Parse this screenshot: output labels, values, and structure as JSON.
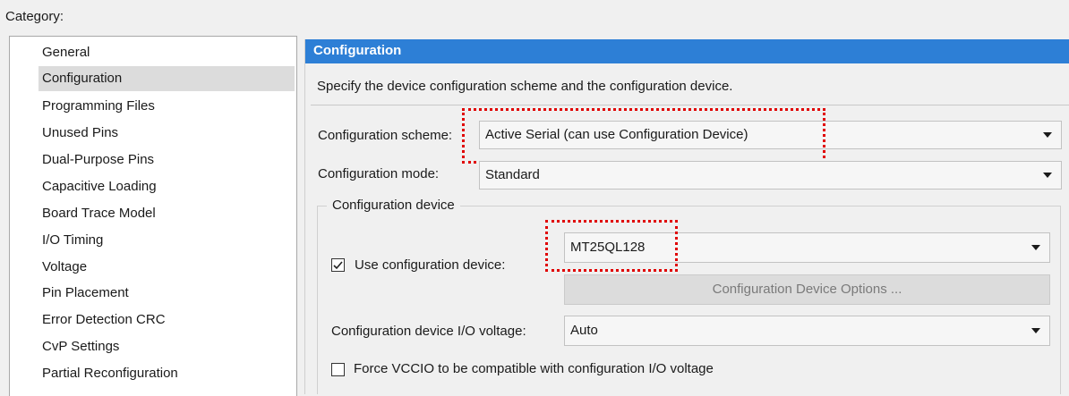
{
  "category": {
    "label": "Category:",
    "items": [
      {
        "label": "General"
      },
      {
        "label": "Configuration",
        "selected": true
      },
      {
        "label": "Programming Files"
      },
      {
        "label": "Unused Pins"
      },
      {
        "label": "Dual-Purpose Pins"
      },
      {
        "label": "Capacitive Loading"
      },
      {
        "label": "Board Trace Model"
      },
      {
        "label": "I/O Timing"
      },
      {
        "label": "Voltage"
      },
      {
        "label": "Pin Placement"
      },
      {
        "label": "Error Detection CRC"
      },
      {
        "label": "CvP Settings"
      },
      {
        "label": "Partial Reconfiguration"
      }
    ]
  },
  "panel": {
    "title": "Configuration",
    "description": "Specify the device configuration scheme and the configuration device.",
    "scheme": {
      "label": "Configuration scheme:",
      "value": "Active Serial (can use Configuration Device)"
    },
    "mode": {
      "label": "Configuration mode:",
      "value": "Standard"
    },
    "device_group": {
      "title": "Configuration device",
      "use_device": {
        "label": "Use configuration device:",
        "checked": true
      },
      "device": {
        "value": "MT25QL128"
      },
      "options_button": "Configuration Device Options ...",
      "io_voltage": {
        "label": "Configuration device I/O voltage:",
        "value": "Auto"
      },
      "force_vccio": {
        "label": "Force VCCIO to be compatible with configuration I/O voltage",
        "checked": false
      }
    }
  },
  "colors": {
    "header_bg": "#2d7fd6",
    "selected_item_bg": "#dcdcdc",
    "highlight": "#e00000"
  },
  "icons": {
    "dropdown": "caret-down-icon",
    "checkbox_checked": "check-icon"
  }
}
